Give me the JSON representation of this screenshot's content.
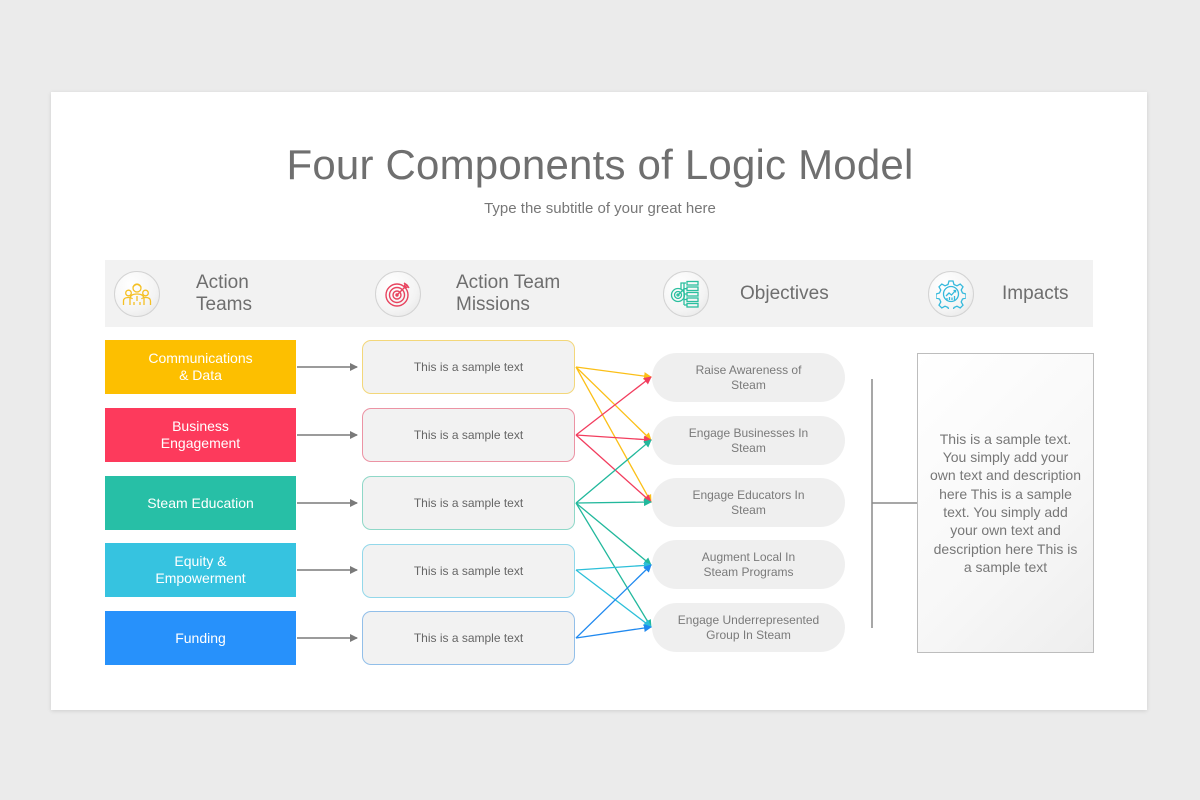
{
  "title": "Four Components of Logic Model",
  "subtitle": "Type the subtitle of your great here",
  "headers": [
    {
      "label": "Action\nTeams",
      "icon": "team-icon",
      "color": "#f5c024"
    },
    {
      "label": "Action Team\nMissions",
      "icon": "target-icon",
      "color": "#e8445f"
    },
    {
      "label": "Objectives",
      "icon": "objectives-icon",
      "color": "#2bbf9f"
    },
    {
      "label": "Impacts",
      "icon": "gear-chart-icon",
      "color": "#35b9dc"
    }
  ],
  "teams": [
    {
      "label": "Communications\n& Data",
      "color": "#fdbf00"
    },
    {
      "label": "Business\nEngagement",
      "color": "#fd3a5c"
    },
    {
      "label": "Steam Education",
      "color": "#27bfa6"
    },
    {
      "label": "Equity &\nEmpowerment",
      "color": "#36c3e0"
    },
    {
      "label": "Funding",
      "color": "#2791fb"
    }
  ],
  "missions": [
    {
      "label": "This is a sample text",
      "border": "#f3d77a",
      "line_color": "#fbbf17",
      "targets": [
        0,
        1,
        2
      ]
    },
    {
      "label": "This is a sample text",
      "border": "#ec93a4",
      "line_color": "#f23d5e",
      "targets": [
        0,
        1,
        2
      ]
    },
    {
      "label": "This is a sample text",
      "border": "#8fd8c8",
      "line_color": "#22b89c",
      "targets": [
        1,
        2,
        3,
        4
      ]
    },
    {
      "label": "This is a sample text",
      "border": "#93d8ea",
      "line_color": "#2cbfd9",
      "targets": [
        3,
        4
      ]
    },
    {
      "label": "This is a sample text",
      "border": "#92bfe9",
      "line_color": "#2089ef",
      "targets": [
        3,
        4
      ]
    }
  ],
  "objectives": [
    {
      "label": "Raise Awareness of\nSteam"
    },
    {
      "label": "Engage Businesses In\nSteam"
    },
    {
      "label": "Engage Educators In\nSteam"
    },
    {
      "label": "Augment Local In\nSteam Programs"
    },
    {
      "label": "Engage Underrepresented\nGroup In Steam"
    }
  ],
  "impact": {
    "text": "This is a sample text. You simply add your own text and description here This is a sample text. You simply add your own text and description here This is a sample text"
  }
}
